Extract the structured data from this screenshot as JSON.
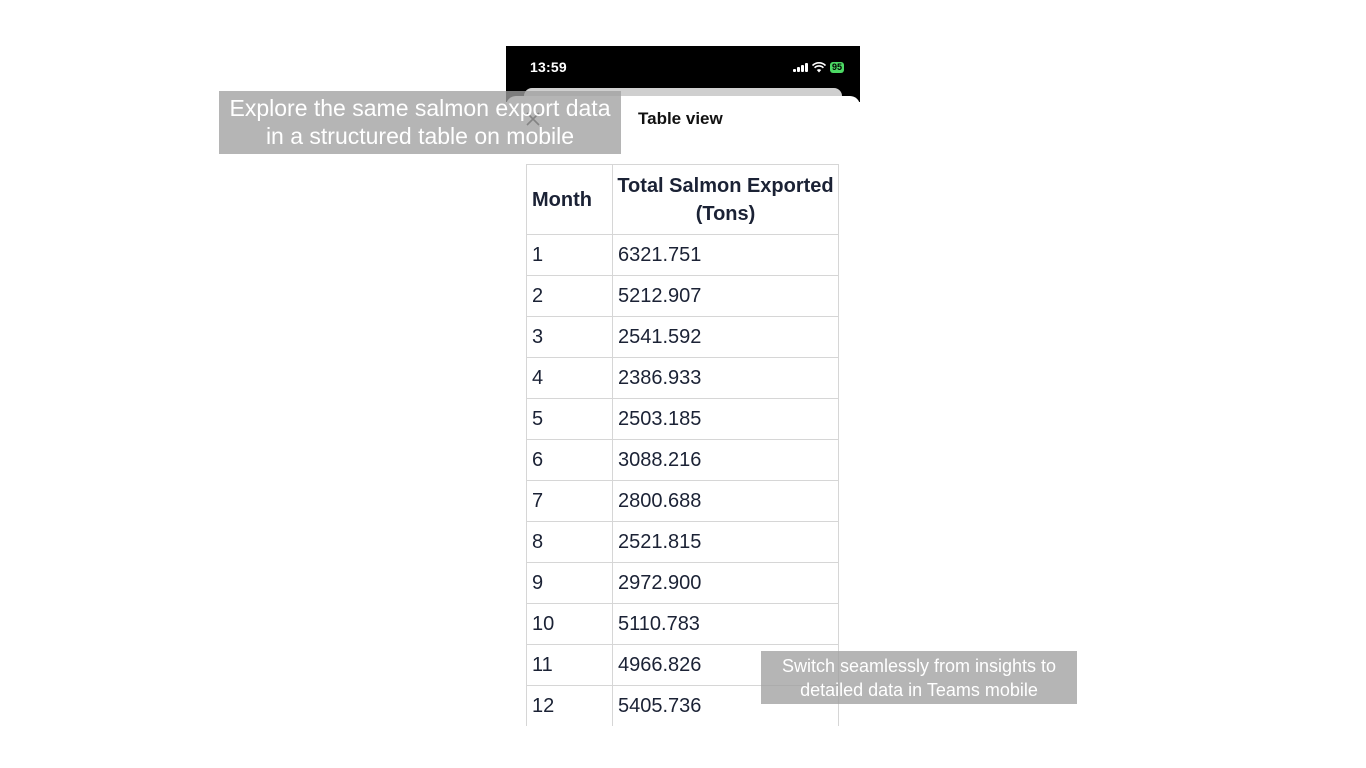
{
  "status_bar": {
    "time": "13:59",
    "battery": "95"
  },
  "sheet": {
    "title": "Table view",
    "close_icon": "close-icon"
  },
  "table": {
    "headers": [
      "Month",
      "Total Salmon Exported (Tons)"
    ],
    "rows": [
      [
        "1",
        "6321.751"
      ],
      [
        "2",
        "5212.907"
      ],
      [
        "3",
        "2541.592"
      ],
      [
        "4",
        "2386.933"
      ],
      [
        "5",
        "2503.185"
      ],
      [
        "6",
        "3088.216"
      ],
      [
        "7",
        "2800.688"
      ],
      [
        "8",
        "2521.815"
      ],
      [
        "9",
        "2972.900"
      ],
      [
        "10",
        "5110.783"
      ],
      [
        "11",
        "4966.826"
      ],
      [
        "12",
        "5405.736"
      ]
    ]
  },
  "captions": {
    "top": "Explore the same salmon export data in a structured table on mobile",
    "bottom": "Switch seamlessly from insights to detailed data in Teams mobile"
  },
  "colors": {
    "status_bar_bg": "#000000",
    "battery": "#4cd964",
    "table_text": "#1b2235",
    "caption_bg": "#a0a0a0"
  }
}
